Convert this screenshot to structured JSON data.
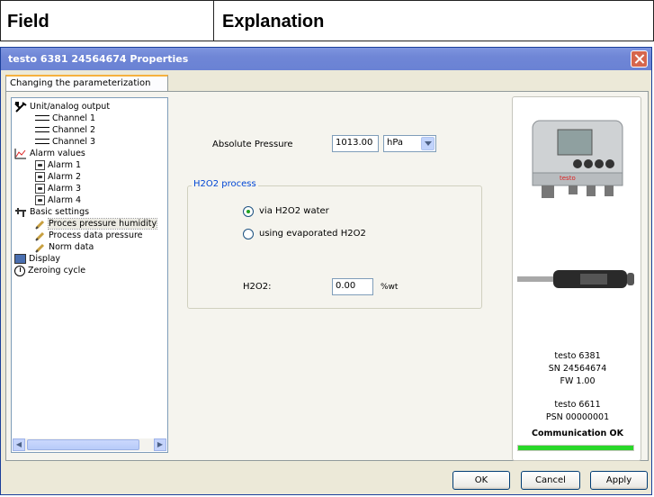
{
  "header": {
    "col1": "Field",
    "col2": "Explanation"
  },
  "window": {
    "title": "testo 6381  24564674 Properties"
  },
  "tab": {
    "label": "Changing the parameterization"
  },
  "tree": {
    "unit": "Unit/analog output",
    "ch1": "Channel 1",
    "ch2": "Channel 2",
    "ch3": "Channel 3",
    "alarmvalues": "Alarm values",
    "a1": "Alarm 1",
    "a2": "Alarm 2",
    "a3": "Alarm 3",
    "a4": "Alarm 4",
    "basic": "Basic settings",
    "proces": "Proces pressure humidity",
    "procdata": "Process data pressure",
    "norm": "Norm data",
    "display": "Display",
    "zero": "Zeroing cycle"
  },
  "form": {
    "abs_label": "Absolute Pressure",
    "abs_value": "1013.00",
    "unit_selected": "hPa",
    "group_title": "H2O2 process",
    "radio1": "via H2O2 water",
    "radio2": "using evaporated H2O2",
    "h2o2_label": "H2O2:",
    "h2o2_value": "0.00",
    "h2o2_unit": "%wt"
  },
  "device": {
    "line1": "testo 6381",
    "line2": "SN 24564674",
    "line3": "FW  1.00",
    "line4": "testo 6611",
    "line5": "PSN 00000001",
    "status": "Communication OK",
    "progress": 1.0
  },
  "buttons": {
    "ok": "OK",
    "cancel": "Cancel",
    "apply": "Apply"
  }
}
